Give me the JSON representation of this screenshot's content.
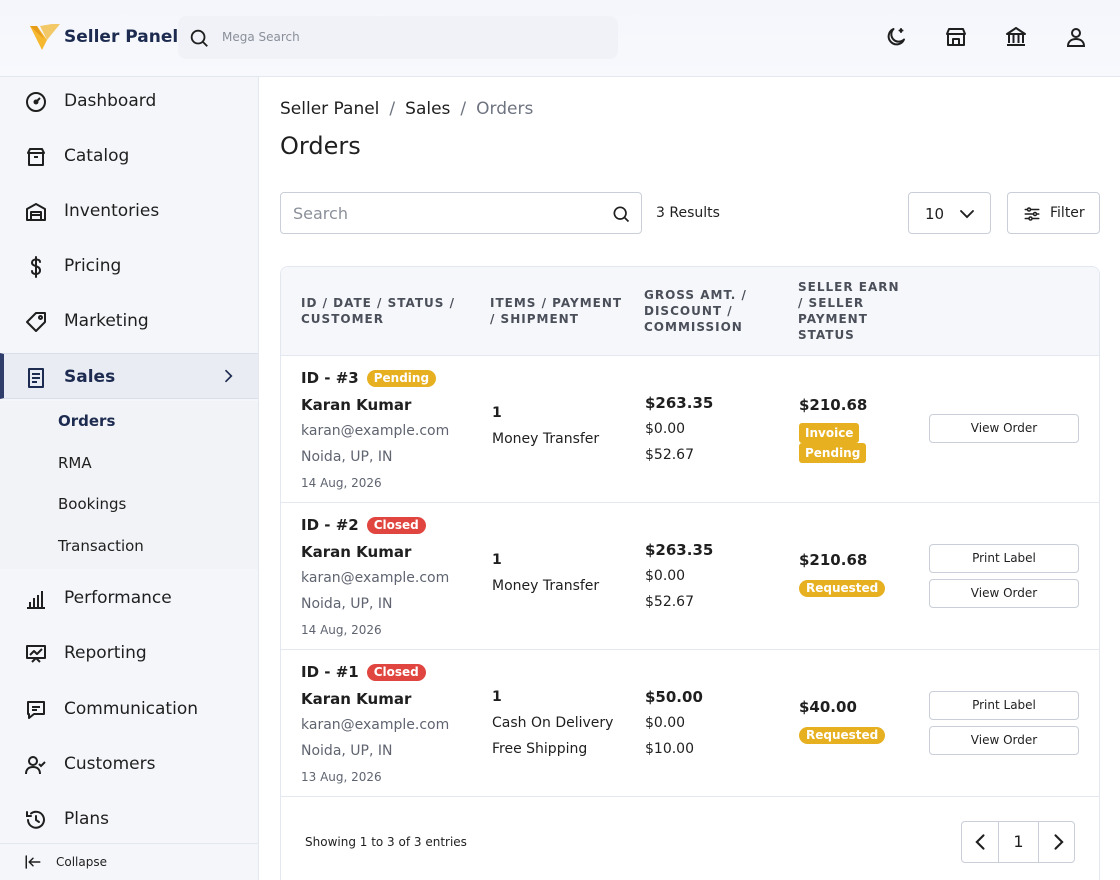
{
  "header": {
    "brand": "Seller Panel",
    "search_placeholder": "Mega Search",
    "icons": [
      "moon-icon",
      "store-icon",
      "bank-icon",
      "user-icon"
    ]
  },
  "sidebar": {
    "items": [
      {
        "label": "Dashboard",
        "icon": "dashboard-icon"
      },
      {
        "label": "Catalog",
        "icon": "catalog-icon"
      },
      {
        "label": "Inventories",
        "icon": "warehouse-icon"
      },
      {
        "label": "Pricing",
        "icon": "dollar-icon"
      },
      {
        "label": "Marketing",
        "icon": "tag-icon"
      },
      {
        "label": "Sales",
        "icon": "receipt-icon"
      },
      {
        "label": "Performance",
        "icon": "bar-chart-icon"
      },
      {
        "label": "Reporting",
        "icon": "report-icon"
      },
      {
        "label": "Communication",
        "icon": "message-icon"
      },
      {
        "label": "Customers",
        "icon": "customers-icon"
      },
      {
        "label": "Plans",
        "icon": "history-icon"
      }
    ],
    "sales_sub": [
      "Orders",
      "RMA",
      "Bookings",
      "Transaction"
    ],
    "collapse_label": "Collapse"
  },
  "breadcrumb": {
    "root": "Seller Panel",
    "section": "Sales",
    "current": "Orders",
    "sep": "/"
  },
  "page_title": "Orders",
  "toolbar": {
    "search_placeholder": "Search",
    "results": "3 Results",
    "page_size": "10",
    "filter_label": "Filter"
  },
  "table": {
    "headers": [
      "ID / DATE / STATUS / CUSTOMER",
      "ITEMS / PAYMENT / SHIPMENT",
      "GROSS AMT. / DISCOUNT / COMMISSION",
      "SELLER EARN / SELLER PAYMENT STATUS"
    ],
    "rows": [
      {
        "id": "ID - #3",
        "status": "Pending",
        "customer": "Karan Kumar",
        "email": "karan@example.com",
        "location": "Noida, UP, IN",
        "date": "14 Aug, 2026",
        "items": "1",
        "payment": "Money Transfer",
        "shipment": "",
        "gross": "$263.35",
        "discount": "$0.00",
        "commission": "$52.67",
        "earn": "$210.68",
        "payment_status_l1": "Invoice",
        "payment_status_l2": "Pending",
        "actions": [
          "View Order"
        ]
      },
      {
        "id": "ID - #2",
        "status": "Closed",
        "customer": "Karan Kumar",
        "email": "karan@example.com",
        "location": "Noida, UP, IN",
        "date": "14 Aug, 2026",
        "items": "1",
        "payment": "Money Transfer",
        "shipment": "",
        "gross": "$263.35",
        "discount": "$0.00",
        "commission": "$52.67",
        "earn": "$210.68",
        "payment_status_l1": "Requested",
        "payment_status_l2": "",
        "actions": [
          "Print Label",
          "View Order"
        ]
      },
      {
        "id": "ID - #1",
        "status": "Closed",
        "customer": "Karan Kumar",
        "email": "karan@example.com",
        "location": "Noida, UP, IN",
        "date": "13 Aug, 2026",
        "items": "1",
        "payment": "Cash On Delivery",
        "shipment": "Free Shipping",
        "gross": "$50.00",
        "discount": "$0.00",
        "commission": "$10.00",
        "earn": "$40.00",
        "payment_status_l1": "Requested",
        "payment_status_l2": "",
        "actions": [
          "Print Label",
          "View Order"
        ]
      }
    ]
  },
  "footer": {
    "showing": "Showing 1 to 3 of 3 entries",
    "page": "1"
  },
  "colors": {
    "brand": "#1d2b50",
    "pending": "#e6b020",
    "closed": "#e0453f",
    "logo_yellow": "#f5b82e",
    "logo_blue": "#1d2b50"
  }
}
